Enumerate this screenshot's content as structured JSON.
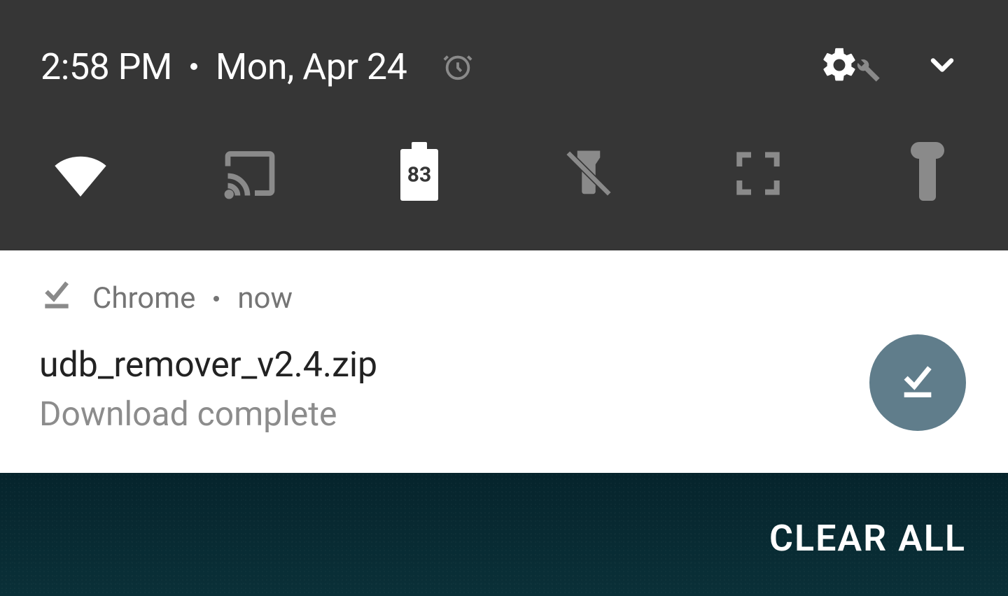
{
  "quick_settings": {
    "time": "2:58 PM",
    "date": "Mon, Apr 24",
    "tiles": {
      "wifi": {
        "active": true
      },
      "cast": {
        "active": false
      },
      "battery": {
        "level": "83"
      },
      "flashlight_off": {
        "active": false
      },
      "screenshot": {
        "active": false
      },
      "flashlight": {
        "active": false
      }
    }
  },
  "notification": {
    "app": "Chrome",
    "time": "now",
    "title": "udb_remover_v2.4.zip",
    "subtitle": "Download complete"
  },
  "actions": {
    "clear_all": "CLEAR ALL"
  },
  "colors": {
    "panel_bg": "#363636",
    "tile_inactive": "#888888",
    "tile_active": "#ffffff",
    "notif_badge": "#607d8b"
  }
}
